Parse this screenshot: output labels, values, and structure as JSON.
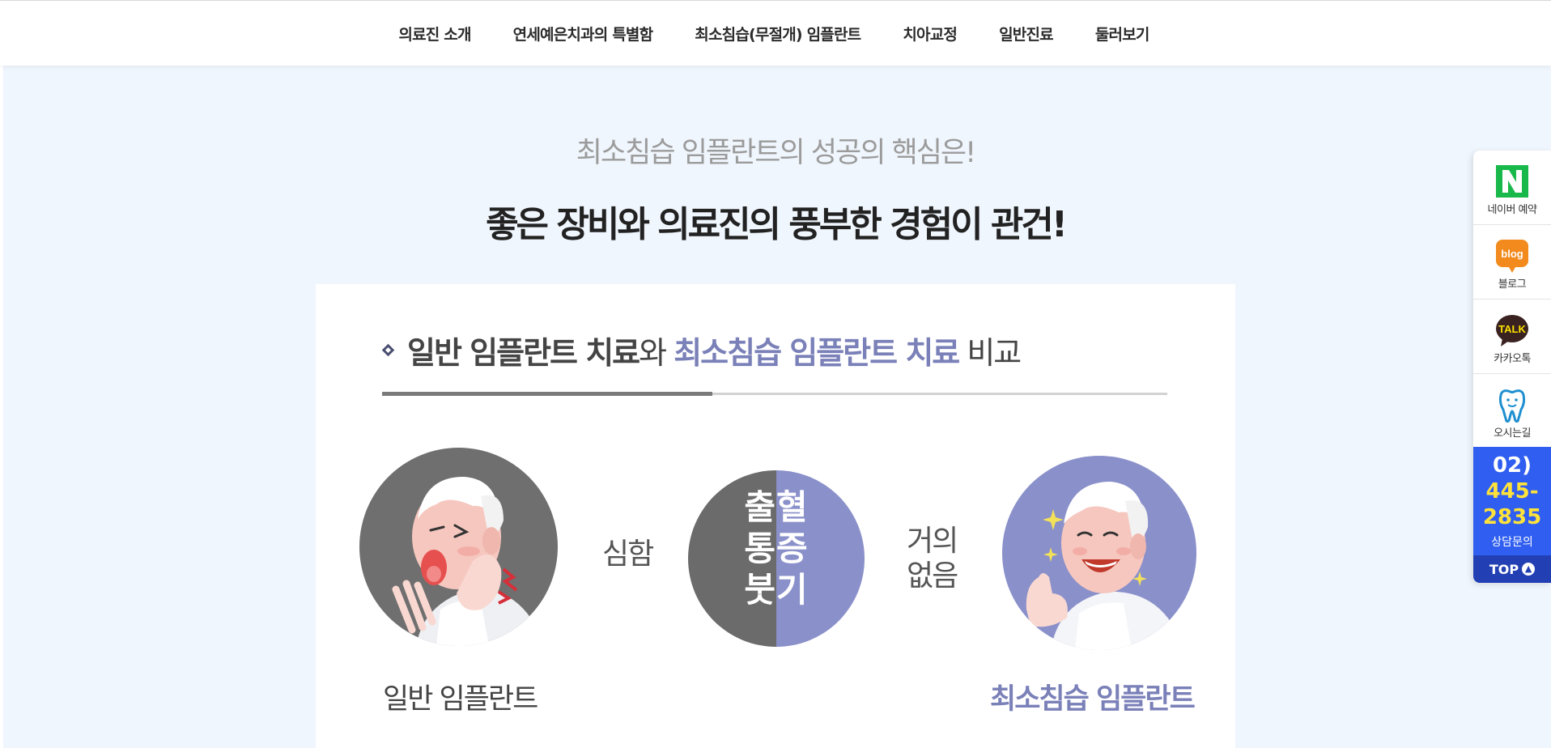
{
  "nav": {
    "items": [
      {
        "label": "의료진 소개"
      },
      {
        "label": "연세예은치과의 특별함"
      },
      {
        "label": "최소침습(무절개) 임플란트"
      },
      {
        "label": "치아교정"
      },
      {
        "label": "일반진료"
      },
      {
        "label": "둘러보기"
      }
    ]
  },
  "headline": {
    "sub": "최소침습 임플란트의 성공의 핵심은!",
    "main": "좋은 장비와 의료진의 풍부한 경험이 관건!"
  },
  "comparison": {
    "title_part1": "일반 임플란트 치료",
    "title_part2": "와 ",
    "title_part3": "최소침습 임플란트 치료",
    "title_part4": " 비교",
    "symptoms": {
      "line1": "출혈",
      "line2": "통증",
      "line3": "붓기"
    },
    "general_level": "심함",
    "mini_level_line1": "거의",
    "mini_level_line2": "없음",
    "general_label": "일반 임플란트",
    "mini_label": "최소침습 임플란트"
  },
  "quickbar": {
    "naver_label": "네이버 예약",
    "naver_glyph": "N",
    "blog_label": "블로그",
    "blog_glyph": "blog",
    "talk_label": "카카오톡",
    "talk_glyph": "TALK",
    "map_label": "오시는길",
    "phone_line1": "02)",
    "phone_line2": "445-",
    "phone_line3": "2835",
    "phone_caption": "상담문의",
    "top_label": "TOP"
  },
  "colors": {
    "accent_purple": "#7a80b8",
    "circle_gray": "#6f6f6f",
    "phone_blue": "#2f5ef0",
    "naver_green": "#19b84b",
    "blog_orange": "#f28a1e",
    "talk_brown": "#3a2220"
  }
}
